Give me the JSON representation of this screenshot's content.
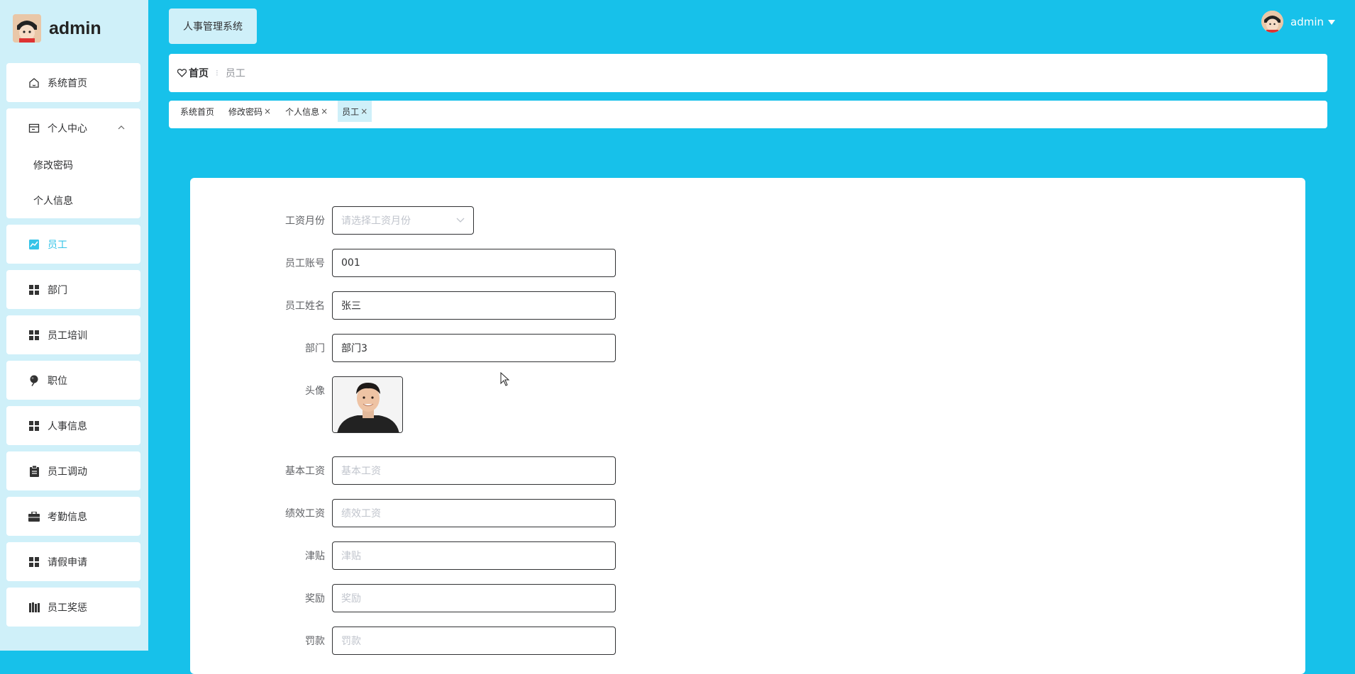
{
  "brand": {
    "name": "admin"
  },
  "sidebar": {
    "items": [
      {
        "label": "系统首页",
        "icon": "home-icon"
      },
      {
        "label": "个人中心",
        "icon": "calendar-icon",
        "sub": [
          "修改密码",
          "个人信息"
        ]
      },
      {
        "label": "员工",
        "icon": "chart-icon"
      },
      {
        "label": "部门",
        "icon": "grid-icon"
      },
      {
        "label": "员工培训",
        "icon": "grid-icon"
      },
      {
        "label": "职位",
        "icon": "pin-icon"
      },
      {
        "label": "人事信息",
        "icon": "grid-icon"
      },
      {
        "label": "员工调动",
        "icon": "clipboard-icon"
      },
      {
        "label": "考勤信息",
        "icon": "briefcase-icon"
      },
      {
        "label": "请假申请",
        "icon": "grid-icon"
      },
      {
        "label": "员工奖惩",
        "icon": "book-icon"
      }
    ]
  },
  "header": {
    "system_title": "人事管理系统",
    "user": "admin"
  },
  "breadcrumb": {
    "home": "首页",
    "current": "员工"
  },
  "tags": [
    {
      "label": "系统首页",
      "closable": false
    },
    {
      "label": "修改密码",
      "closable": true
    },
    {
      "label": "个人信息",
      "closable": true
    },
    {
      "label": "员工",
      "closable": true
    }
  ],
  "form": {
    "month": {
      "label": "工资月份",
      "placeholder": "请选择工资月份"
    },
    "account": {
      "label": "员工账号",
      "value": "001"
    },
    "name": {
      "label": "员工姓名",
      "value": "张三"
    },
    "dept": {
      "label": "部门",
      "value": "部门3"
    },
    "avatar": {
      "label": "头像"
    },
    "base_salary": {
      "label": "基本工资",
      "placeholder": "基本工资"
    },
    "perf_salary": {
      "label": "绩效工资",
      "placeholder": "绩效工资"
    },
    "allowance": {
      "label": "津贴",
      "placeholder": "津贴"
    },
    "bonus": {
      "label": "奖励",
      "placeholder": "奖励"
    },
    "penalty": {
      "label": "罚款",
      "placeholder": "罚款"
    }
  },
  "colors": {
    "accent": "#17c1ea",
    "sidebar_bg": "#cff0f9",
    "active_text": "#36c4e8"
  }
}
